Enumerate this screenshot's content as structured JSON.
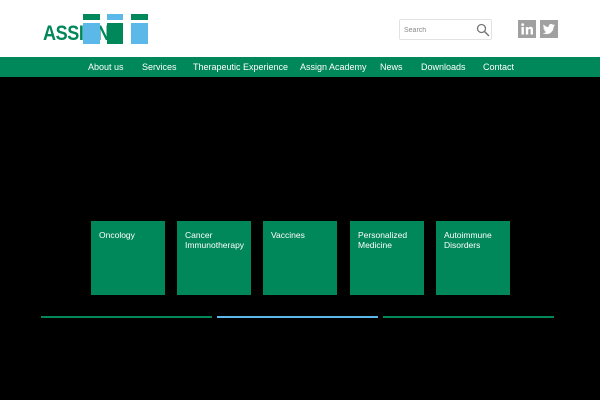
{
  "header": {
    "logo_text": "ASSIGN",
    "search_placeholder": "Search",
    "social": [
      "linkedin-icon",
      "twitter-icon"
    ]
  },
  "nav": {
    "items": [
      "About us",
      "Services",
      "Therapeutic Experience",
      "Assign Academy",
      "News",
      "Downloads",
      "Contact"
    ]
  },
  "tiles": [
    "Oncology",
    "Cancer\nImmunotherapy",
    "Vaccines",
    "Personalized\nMedicine",
    "Autoimmune\nDisorders"
  ],
  "slider": {
    "active_index": 1,
    "active_color": "#5bb8e8",
    "inactive_color": "#00875a"
  },
  "colors": {
    "brand_green": "#00875a",
    "brand_blue": "#5bb8e8",
    "icon_gray": "#a0a0a0"
  }
}
